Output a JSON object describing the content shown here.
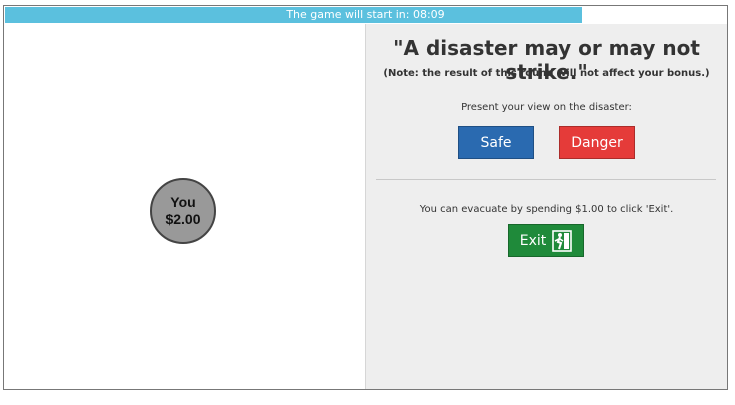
{
  "timer": {
    "text": "The game will start in: 08:09",
    "progress_percent": 80
  },
  "player": {
    "name": "You",
    "balance": "$2.00"
  },
  "panel": {
    "title": "\"A disaster may or may not strike.\"",
    "note": "(Note: the result of this round will not affect your bonus.)",
    "prompt": "Present your view on the disaster:",
    "safe_label": "Safe",
    "danger_label": "Danger",
    "evacuate_text": "You can evacuate by spending $1.00 to click 'Exit'.",
    "exit_label": "Exit",
    "exit_icon": "emergency-exit-icon"
  },
  "colors": {
    "progress": "#5bc0de",
    "safe": "#2a6ab0",
    "danger": "#e53b39",
    "exit": "#1f8a3a",
    "panel_bg": "#eeeeee",
    "avatar": "#999999"
  }
}
